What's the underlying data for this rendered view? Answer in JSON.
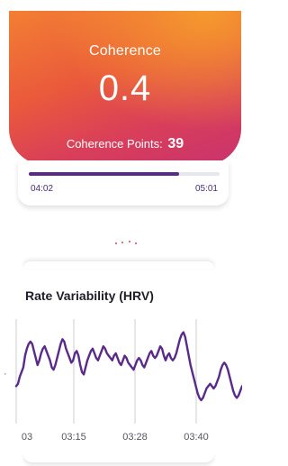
{
  "coherence": {
    "title": "Coherence",
    "value": "0.4",
    "points_label": "Coherence Points:",
    "points_value": "39",
    "gradient_colors": [
      "#f59a2e",
      "#ea5a3b",
      "#c8336e"
    ]
  },
  "session": {
    "elapsed": "04:02",
    "total": "05:01",
    "progress_fraction": 0.79,
    "accent_color": "#5a2a8a"
  },
  "hrv": {
    "title": "Rate Variability (HRV)",
    "chart_data": {
      "type": "line",
      "title": "Rate Variability (HRV)",
      "xlabel": "",
      "ylabel": "",
      "x_tick_labels": [
        "03",
        "03:15",
        "03:28",
        "03:40"
      ],
      "x": [
        0,
        1,
        2,
        3,
        4,
        5,
        6,
        7,
        8,
        9,
        10,
        11,
        12,
        13,
        14,
        15,
        16,
        17,
        18,
        19,
        20,
        21,
        22,
        23,
        24,
        25,
        26,
        27,
        28,
        29,
        30,
        31,
        32,
        33,
        34,
        35,
        36,
        37,
        38,
        39,
        40,
        41,
        42,
        43,
        44,
        45,
        46,
        47,
        48,
        49,
        50,
        51,
        52,
        53,
        54,
        55,
        56,
        57,
        58,
        59,
        60,
        61,
        62,
        63,
        64,
        65,
        66,
        67,
        68,
        69,
        70,
        71,
        72,
        73,
        74,
        75,
        76,
        77,
        78,
        79,
        80,
        81,
        82,
        83,
        84,
        85,
        86,
        87,
        88,
        89,
        90,
        91,
        92,
        93,
        94,
        95,
        96,
        97,
        98,
        99,
        100,
        101,
        102,
        103,
        104,
        105,
        106,
        107,
        108,
        109,
        110,
        111,
        112,
        113,
        114,
        115,
        116,
        117,
        118,
        119,
        120,
        121,
        122,
        123,
        124,
        125,
        126,
        127
      ],
      "series": [
        {
          "color": "#5a2a8a",
          "values": [
            12,
            14,
            20,
            24,
            28,
            38,
            44,
            48,
            50,
            48,
            42,
            36,
            30,
            34,
            40,
            44,
            46,
            42,
            38,
            34,
            28,
            26,
            30,
            36,
            42,
            48,
            52,
            50,
            44,
            40,
            36,
            32,
            34,
            40,
            42,
            38,
            30,
            24,
            22,
            28,
            34,
            38,
            42,
            44,
            40,
            36,
            34,
            38,
            42,
            46,
            44,
            40,
            38,
            36,
            34,
            38,
            40,
            36,
            32,
            30,
            34,
            38,
            36,
            32,
            30,
            28,
            26,
            30,
            34,
            36,
            34,
            30,
            28,
            32,
            36,
            40,
            42,
            38,
            36,
            38,
            42,
            46,
            44,
            38,
            34,
            38,
            40,
            36,
            34,
            36,
            40,
            46,
            52,
            56,
            58,
            54,
            46,
            38,
            30,
            24,
            18,
            12,
            6,
            2,
            0,
            2,
            6,
            10,
            12,
            14,
            12,
            10,
            12,
            16,
            20,
            26,
            30,
            32,
            30,
            26,
            20,
            14,
            8,
            4,
            2,
            4,
            8,
            12
          ]
        }
      ],
      "ylim": [
        0,
        60
      ],
      "grid": "vertical"
    }
  }
}
